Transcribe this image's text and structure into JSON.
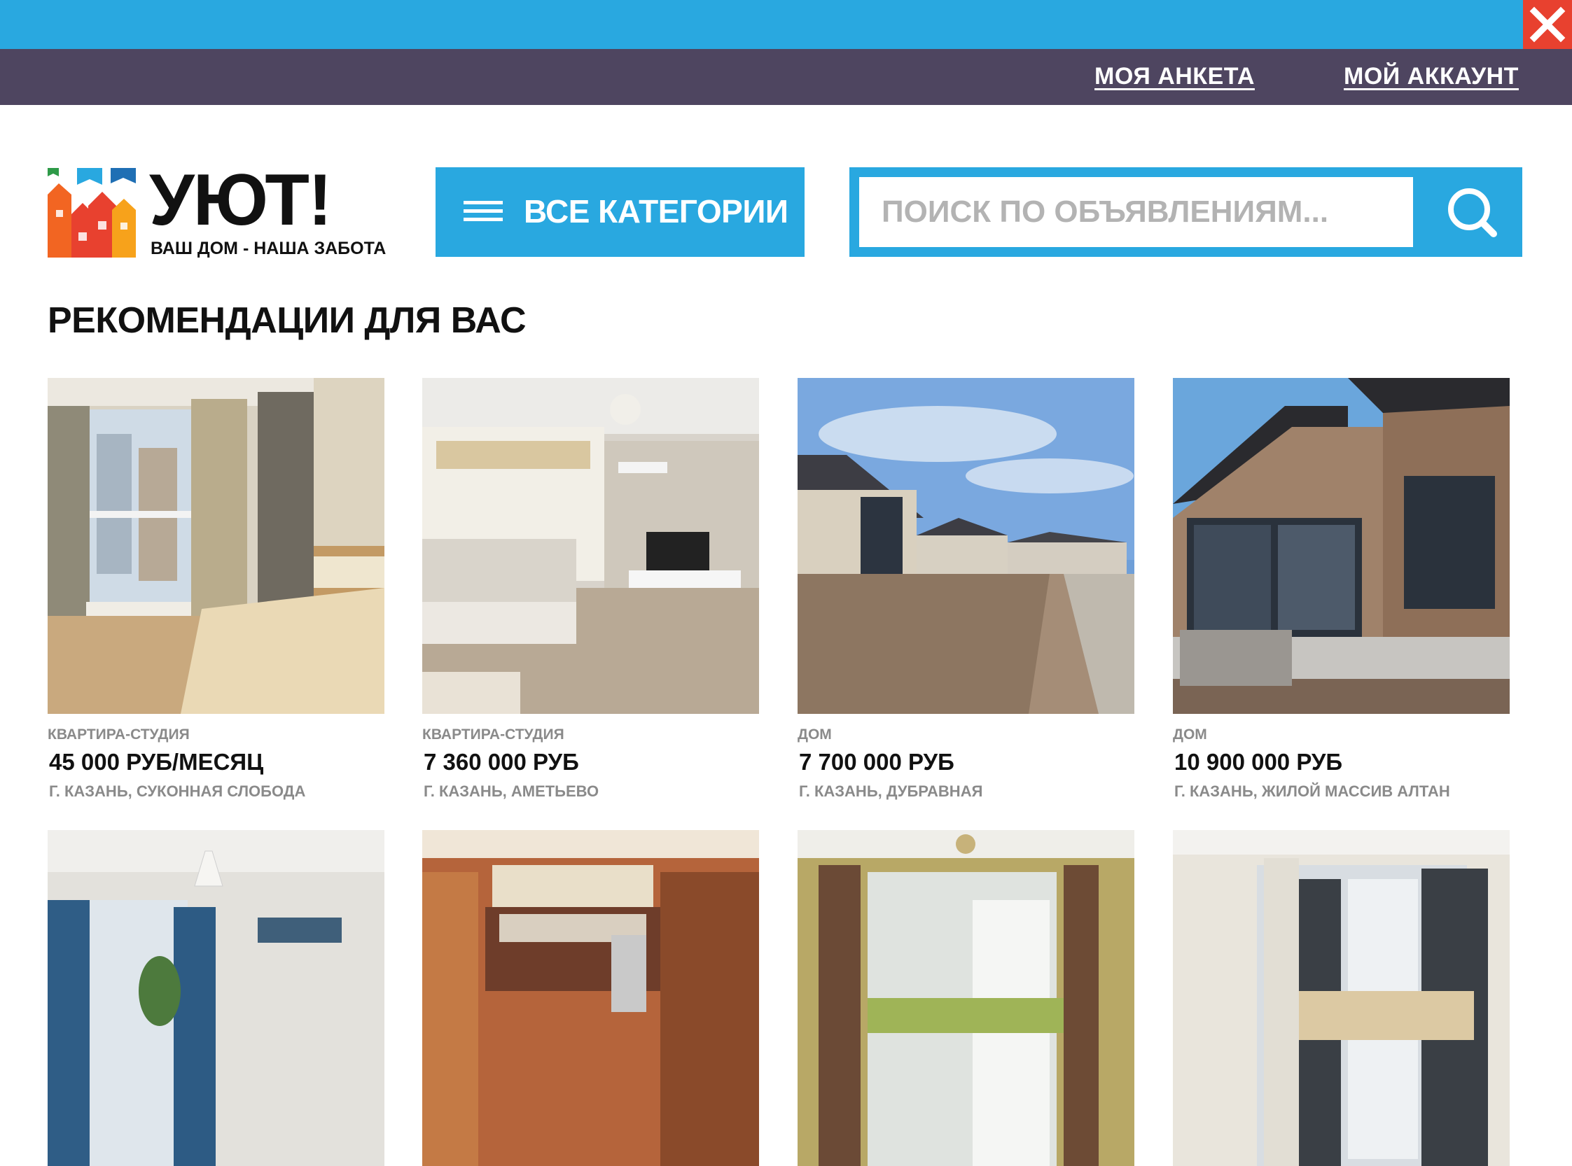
{
  "topbar": {
    "close_icon": "close-icon",
    "colors": {
      "bar": "#29a8e0",
      "close": "#e8412f"
    }
  },
  "account_nav": {
    "my_profile": "МОЯ АНКЕТА",
    "my_account": "МОЙ АККАУНТ",
    "background": "#4e4560"
  },
  "logo": {
    "title": "УЮТ!",
    "subtitle": "ВАШ ДОМ - НАША ЗАБОТА"
  },
  "categories_button": {
    "label": "ВСЕ КАТЕГОРИИ",
    "icon": "menu-icon"
  },
  "search": {
    "placeholder": "ПОИСК ПО ОБЪЯВЛЕНИЯМ...",
    "value": "",
    "icon": "search-icon"
  },
  "recommendations": {
    "title": "РЕКОМЕНДАЦИИ ДЛЯ ВАС",
    "listings": [
      {
        "type": "КВАРТИРА-СТУДИЯ",
        "price": "45 000 РУБ/МЕСЯЦ",
        "address": "Г. КАЗАНЬ, СУКОННАЯ СЛОБОДА"
      },
      {
        "type": "КВАРТИРА-СТУДИЯ",
        "price": "7 360 000 РУБ",
        "address": "Г. КАЗАНЬ, АМЕТЬЕВО"
      },
      {
        "type": "ДОМ",
        "price": "7 700 000 РУБ",
        "address": "Г. КАЗАНЬ, ДУБРАВНАЯ"
      },
      {
        "type": "ДОМ",
        "price": "10 900 000 РУБ",
        "address": "Г. КАЗАНЬ, ЖИЛОЙ МАССИВ АЛТАН"
      }
    ]
  },
  "accent_color": "#29a8e0"
}
